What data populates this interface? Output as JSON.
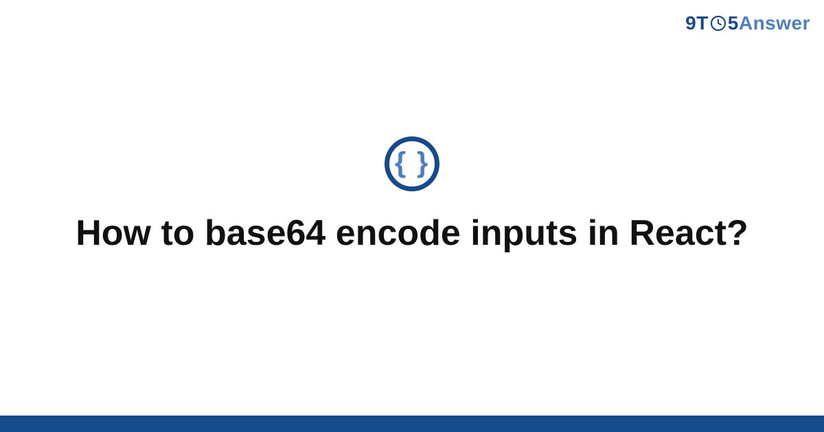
{
  "logo": {
    "part1": "9T",
    "part2": "5",
    "part3": "Answer"
  },
  "badge": {
    "symbol": "{ }",
    "icon_name": "code-braces-icon",
    "border_color": "#174a8a",
    "inner_color": "#4b7fc2"
  },
  "title": "How to base64 encode inputs in React?",
  "footer": {
    "bar_color": "#174a8a"
  },
  "colors": {
    "brand_dark": "#174a8a",
    "brand_light": "#4b7fc2",
    "text": "#111111",
    "background": "#ffffff"
  }
}
